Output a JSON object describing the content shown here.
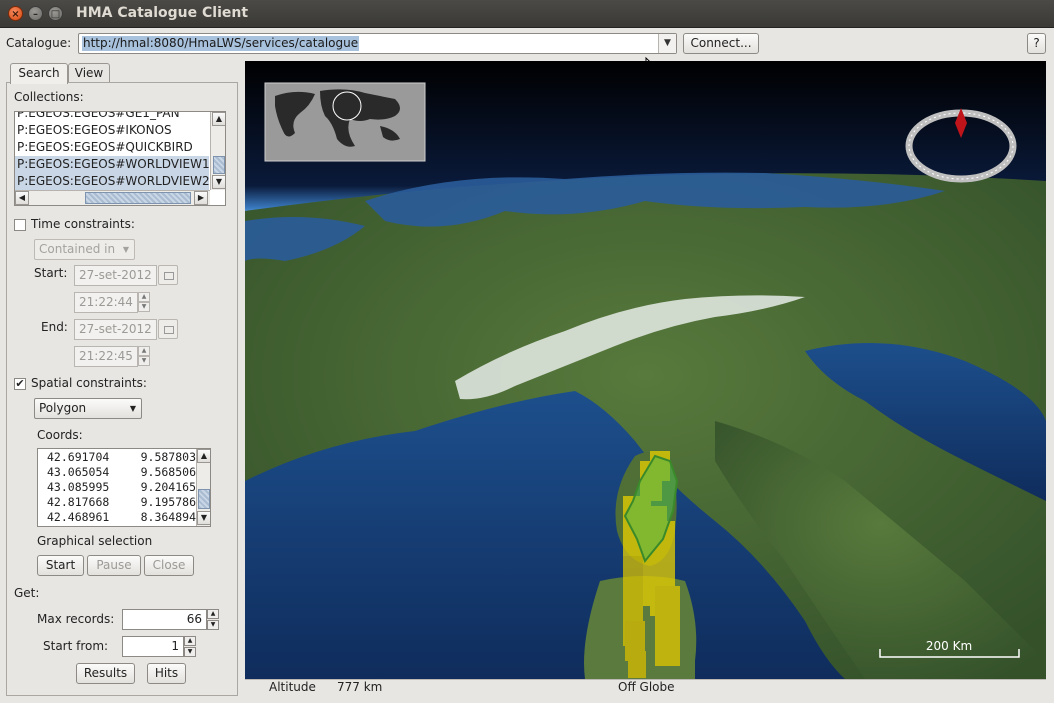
{
  "window": {
    "title": "HMA Catalogue Client",
    "close_glyph": "×",
    "min_glyph": "–",
    "max_glyph": "□"
  },
  "toolbar": {
    "catalogue_label": "Catalogue:",
    "catalogue_url": "http://hmal:8080/HmaLWS/services/catalogue",
    "connect_label": "Connect...",
    "help_label": "?"
  },
  "tabs": [
    {
      "label": "Search",
      "active": true
    },
    {
      "label": "View",
      "active": false
    }
  ],
  "search": {
    "collections_label": "Collections:",
    "collections": [
      {
        "label": "P:EGEOS:EGEOS#GE1_PAN",
        "selected": false
      },
      {
        "label": "P:EGEOS:EGEOS#IKONOS",
        "selected": false
      },
      {
        "label": "P:EGEOS:EGEOS#QUICKBIRD",
        "selected": false
      },
      {
        "label": "P:EGEOS:EGEOS#WORLDVIEW1",
        "selected": true
      },
      {
        "label": "P:EGEOS:EGEOS#WORLDVIEW2",
        "selected": true
      }
    ],
    "time": {
      "label": "Time constraints:",
      "checked": false,
      "mode": "Contained in",
      "start_label": "Start:",
      "start_date": "27-set-2012",
      "start_time": "21:22:44",
      "end_label": "End:",
      "end_date": "27-set-2012",
      "end_time": "21:22:45"
    },
    "spatial": {
      "label": "Spatial constraints:",
      "checked": true,
      "check_glyph": "✔",
      "shape": "Polygon",
      "coords_label": "Coords:",
      "coords": [
        [
          "42.691704",
          "9.587803"
        ],
        [
          "43.065054",
          "9.568506"
        ],
        [
          "43.085995",
          "9.204165"
        ],
        [
          "42.817668",
          "9.195786"
        ],
        [
          "42.468961",
          "8.364894"
        ]
      ],
      "graphical_label": "Graphical selection",
      "start_label": "Start",
      "pause_label": "Pause",
      "close_label": "Close"
    },
    "get": {
      "label": "Get:",
      "max_records_label": "Max records:",
      "max_records": "66",
      "start_from_label": "Start from:",
      "start_from": "1",
      "results_label": "Results",
      "hits_label": "Hits"
    }
  },
  "globe": {
    "scale_label": "200 Km",
    "colors": {
      "footprint_yellow": "#e8d000",
      "footprint_green": "#4fb84f",
      "ocean": "#16386e",
      "land": "#4a6a34"
    }
  },
  "status": {
    "altitude_label": "Altitude",
    "altitude_value": "777 km",
    "position_text": "Off Globe"
  }
}
